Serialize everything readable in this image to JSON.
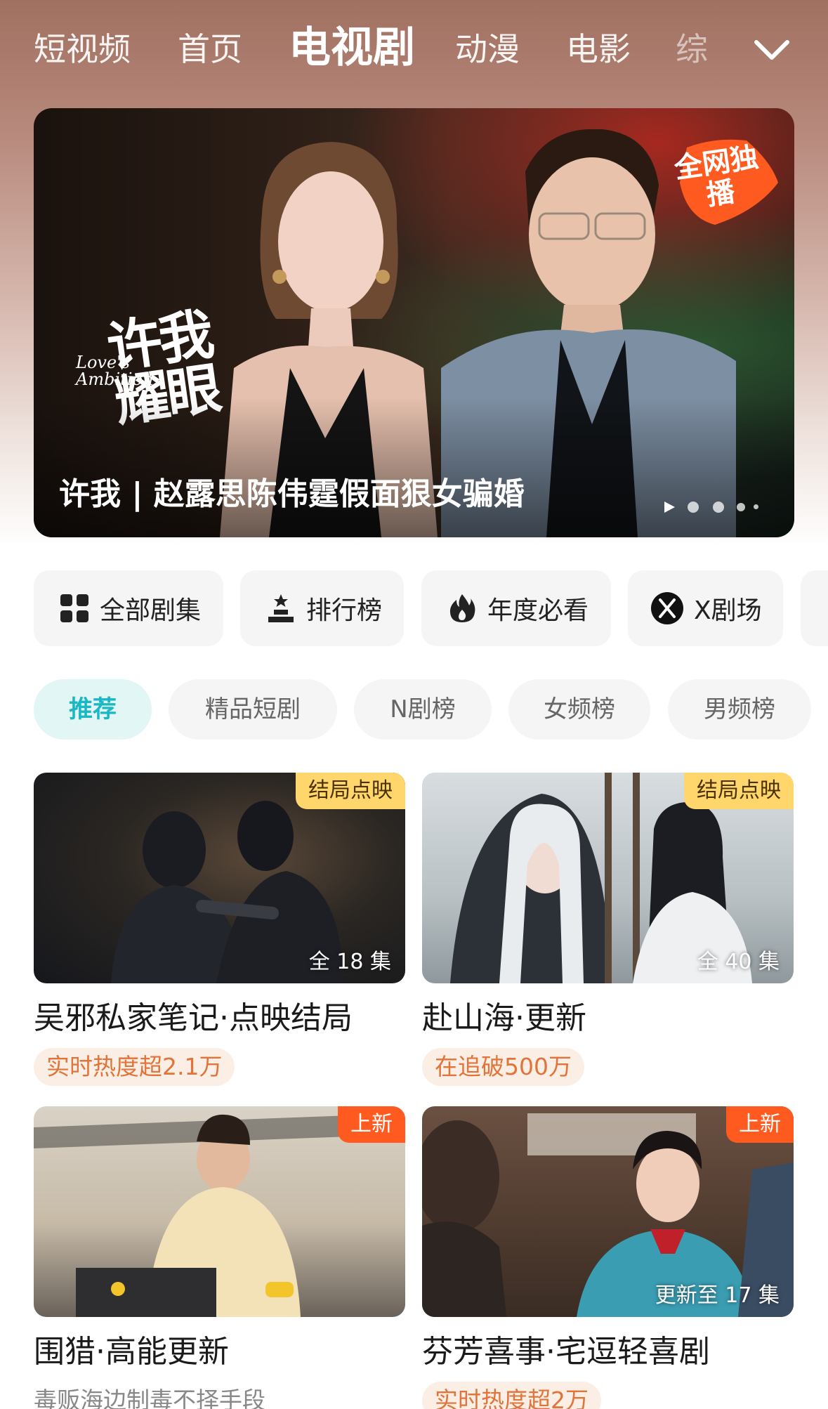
{
  "nav": {
    "tabs": [
      {
        "label": "短视频"
      },
      {
        "label": "首页"
      },
      {
        "label": "电视剧"
      },
      {
        "label": "动漫"
      },
      {
        "label": "电影"
      },
      {
        "label": "综"
      }
    ],
    "active_index": 2,
    "more_icon": "chevron-down-icon"
  },
  "banner": {
    "title_cn": "许我耀眼",
    "title_en": "Love's Ambition",
    "badge": "全网独播",
    "caption": "许我 | 赵露思陈伟霆假面狠女骗婚",
    "page_count": 5,
    "active_page": 0
  },
  "shortcuts": [
    {
      "label": "全部剧集",
      "icon": "grid-icon"
    },
    {
      "label": "排行榜",
      "icon": "trophy-podium-icon"
    },
    {
      "label": "年度必看",
      "icon": "flame-icon"
    },
    {
      "label": "X剧场",
      "icon": "x-theater-icon"
    }
  ],
  "filters": [
    {
      "label": "推荐",
      "active": true
    },
    {
      "label": "精品短剧",
      "active": false
    },
    {
      "label": "N剧榜",
      "active": false
    },
    {
      "label": "女频榜",
      "active": false
    },
    {
      "label": "男频榜",
      "active": false
    }
  ],
  "cards": [
    {
      "badge": "结局点映",
      "episode": "全 18 集",
      "title": "吴邪私家笔记·点映结局",
      "subtitle": "实时热度超2.1万"
    },
    {
      "badge": "结局点映",
      "episode": "全 40 集",
      "title": "赴山海·更新",
      "subtitle": "在追破500万"
    },
    {
      "badge": "上新",
      "episode": "",
      "title": "围猎·高能更新",
      "subtitle": "毒贩海边制毒不择手段"
    },
    {
      "badge": "上新",
      "episode": "更新至 17 集",
      "title": "芬芳喜事·宅逗轻喜剧",
      "subtitle": "实时热度超2万"
    }
  ],
  "colors": {
    "accent": "#19b8c4",
    "badge_yellow": "#ffd66b",
    "badge_orange": "#ff5a1f",
    "hot_text": "#e0743a"
  }
}
